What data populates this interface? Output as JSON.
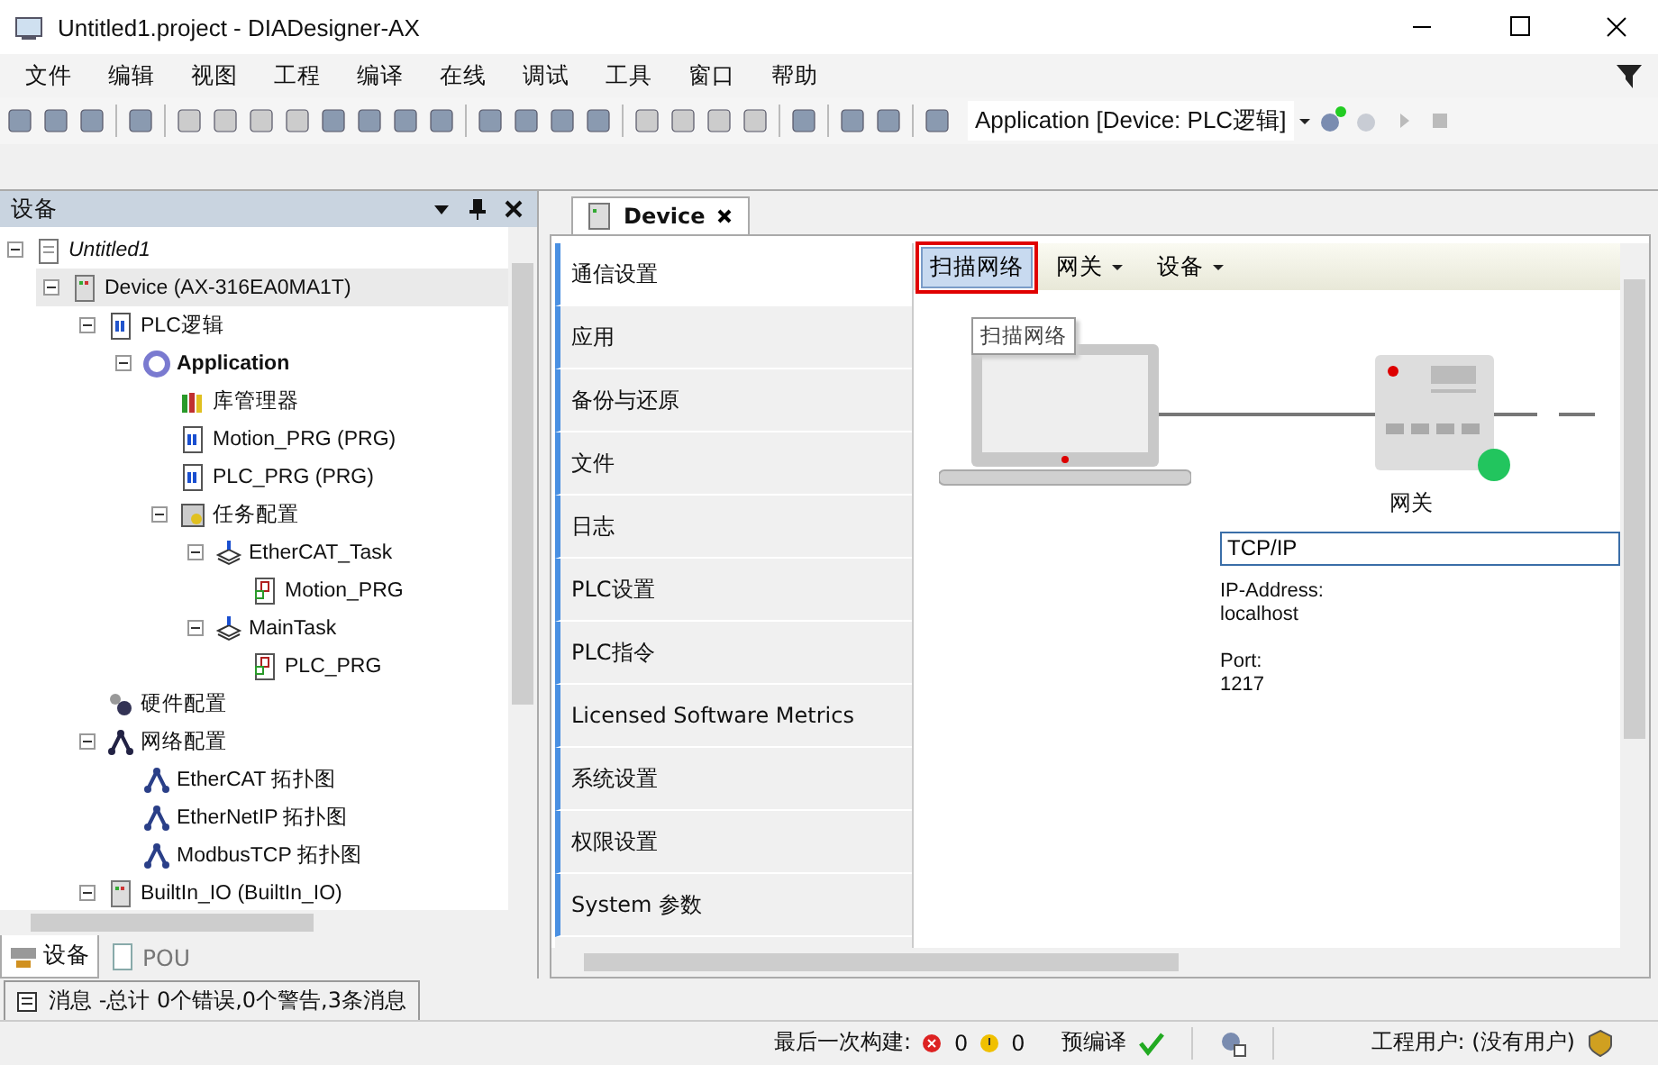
{
  "window": {
    "title": "Untitled1.project - DIADesigner-AX"
  },
  "menu": [
    "文件",
    "编辑",
    "视图",
    "工程",
    "编译",
    "在线",
    "调试",
    "工具",
    "窗口",
    "帮助"
  ],
  "toolbar": {
    "application_selector": "Application [Device: PLC逻辑]"
  },
  "devices_panel": {
    "title": "设备",
    "tree": [
      {
        "label": "Untitled1",
        "kind": "project",
        "expanded": true,
        "selected": false,
        "children": [
          {
            "label": "Device (AX-316EA0MA1T)",
            "kind": "device",
            "expanded": true,
            "selected": true,
            "children": [
              {
                "label": "PLC逻辑",
                "kind": "plc-logic",
                "expanded": true,
                "selected": false,
                "children": [
                  {
                    "label": "Application",
                    "kind": "application",
                    "expanded": true,
                    "selected": false,
                    "children": [
                      {
                        "label": "库管理器",
                        "kind": "library",
                        "selected": false
                      },
                      {
                        "label": "Motion_PRG (PRG)",
                        "kind": "pou",
                        "selected": false
                      },
                      {
                        "label": "PLC_PRG (PRG)",
                        "kind": "pou",
                        "selected": false
                      },
                      {
                        "label": "任务配置",
                        "kind": "task-config",
                        "expanded": true,
                        "selected": false,
                        "children": [
                          {
                            "label": "EtherCAT_Task",
                            "kind": "task",
                            "expanded": true,
                            "selected": false,
                            "children": [
                              {
                                "label": "Motion_PRG",
                                "kind": "program-call",
                                "selected": false
                              }
                            ]
                          },
                          {
                            "label": "MainTask",
                            "kind": "task",
                            "expanded": true,
                            "selected": false,
                            "children": [
                              {
                                "label": "PLC_PRG",
                                "kind": "program-call",
                                "selected": false
                              }
                            ]
                          }
                        ]
                      }
                    ]
                  }
                ]
              },
              {
                "label": "硬件配置",
                "kind": "hardware",
                "selected": false
              },
              {
                "label": "网络配置",
                "kind": "network",
                "expanded": true,
                "selected": false,
                "children": [
                  {
                    "label": "EtherCAT 拓扑图",
                    "kind": "topology",
                    "selected": false
                  },
                  {
                    "label": "EtherNetIP 拓扑图",
                    "kind": "topology",
                    "selected": false
                  },
                  {
                    "label": "ModbusTCP 拓扑图",
                    "kind": "topology",
                    "selected": false
                  }
                ]
              },
              {
                "label": "BuiltIn_IO (BuiltIn_IO)",
                "kind": "device",
                "expanded": true,
                "selected": false
              }
            ]
          }
        ]
      }
    ]
  },
  "bottom_tabs": [
    {
      "label": "设备",
      "kind": "devices",
      "selected": true
    },
    {
      "label": "POU",
      "kind": "pou",
      "selected": false
    }
  ],
  "editor": {
    "tabs": [
      {
        "label": "Device",
        "selected": true
      }
    ],
    "nav": [
      {
        "label": "通信设置",
        "selected": true
      },
      {
        "label": "应用",
        "selected": false
      },
      {
        "label": "备份与还原",
        "selected": false
      },
      {
        "label": "文件",
        "selected": false
      },
      {
        "label": "日志",
        "selected": false
      },
      {
        "label": "PLC设置",
        "selected": false
      },
      {
        "label": "PLC指令",
        "selected": false
      },
      {
        "label": "Licensed Software Metrics",
        "selected": false
      },
      {
        "label": "系统设置",
        "selected": false
      },
      {
        "label": "权限设置",
        "selected": false
      },
      {
        "label": "System 参数",
        "selected": false
      }
    ],
    "toolbar": [
      {
        "label": "扫描网络",
        "kind": "button",
        "highlighted": true
      },
      {
        "label": "网关",
        "kind": "dropdown",
        "highlighted": false
      },
      {
        "label": "设备",
        "kind": "dropdown",
        "highlighted": false
      }
    ],
    "tooltip": "扫描网络",
    "gateway": {
      "label": "网关",
      "online": true,
      "protocol": "TCP/IP",
      "ip_label": "IP-Address:",
      "ip": "localhost",
      "port_label": "Port:",
      "port": "1217"
    }
  },
  "messages_tab": {
    "label": "消息 -总计 0个错误,0个警告,3条消息"
  },
  "status_bar": {
    "last_build_label": "最后一次构建:",
    "errors": "0",
    "warnings": "0",
    "precompile": "预编译",
    "precompile_ok": true,
    "user": "工程用户: (没有用户)"
  }
}
